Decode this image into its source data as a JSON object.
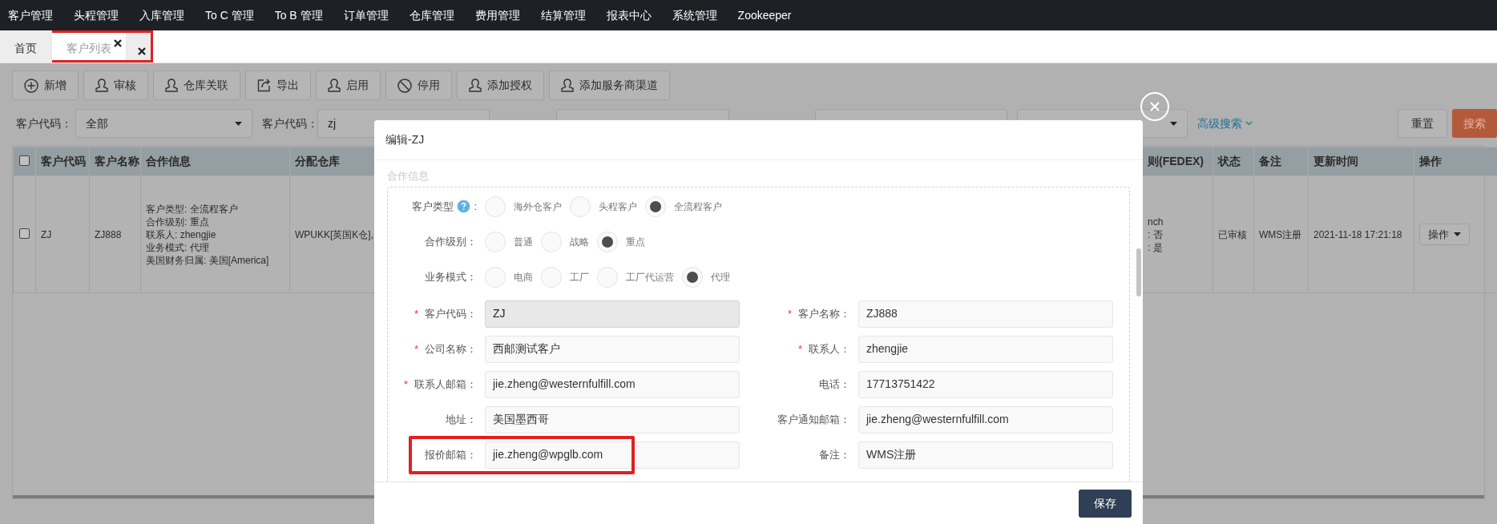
{
  "nav": [
    "客户管理",
    "头程管理",
    "入库管理",
    "To C 管理",
    "To B 管理",
    "订单管理",
    "仓库管理",
    "费用管理",
    "结算管理",
    "报表中心",
    "系统管理",
    "Zookeeper"
  ],
  "tabs": [
    {
      "label": "首页",
      "selected": false,
      "closable": false,
      "highlighted": false
    },
    {
      "label": "客户列表",
      "selected": true,
      "closable": true,
      "highlighted": true
    },
    {
      "selected": false,
      "closable": true,
      "highlighted": true
    }
  ],
  "toolbar": [
    {
      "kind": "plus",
      "label": "新增"
    },
    {
      "kind": "user",
      "label": "审核"
    },
    {
      "kind": "user",
      "label": "仓库关联"
    },
    {
      "kind": "export",
      "label": "导出"
    },
    {
      "kind": "user",
      "label": "启用"
    },
    {
      "kind": "ban",
      "label": "停用"
    },
    {
      "kind": "user",
      "label": "添加授权"
    },
    {
      "kind": "user",
      "label": "添加服务商渠道"
    }
  ],
  "filters": [
    {
      "kind": "select",
      "label": "客户代码：",
      "value": "全部"
    },
    {
      "kind": "text",
      "label": "客户代码：",
      "value": "zj"
    },
    {
      "kind": "text"
    },
    {
      "kind": "text"
    },
    {
      "kind": "select"
    }
  ],
  "advanced_search": "高级搜索",
  "reset_button": "重置",
  "search_button": "搜索",
  "table": {
    "header_checked": false,
    "columns": [
      "客户代码",
      "客户名称",
      "合作信息",
      "分配仓库",
      "则(FEDEX)",
      "状态",
      "备注",
      "更新时间",
      "操作"
    ],
    "rows": [
      {
        "checked": false,
        "cells": [
          "ZJ",
          "ZJ888",
          [
            "客户类型: 全流程客户",
            "合作级别: 重点",
            "联系人: zhengjie",
            "业务模式: 代理",
            "美国财务归属: 美国[America]"
          ],
          "WPUKK[英国K仓],",
          [
            "nch",
            ": 否",
            ": 是"
          ],
          "已审核",
          "WMS注册",
          "2021-11-18 17:21:18",
          {
            "kind": "dropdown",
            "label": "操作"
          }
        ]
      }
    ]
  },
  "modal": {
    "title": "编辑-ZJ",
    "section": "合作信息",
    "radio_groups": [
      {
        "label": "客户类型",
        "help": true,
        "suffix": ":",
        "options": [
          {
            "label": "海外仓客户",
            "selected": false
          },
          {
            "label": "头程客户",
            "selected": false
          },
          {
            "label": "全流程客户",
            "selected": true
          }
        ]
      },
      {
        "label": "合作级别：",
        "help": false,
        "options": [
          {
            "label": "普通",
            "selected": false
          },
          {
            "label": "战略",
            "selected": false
          },
          {
            "label": "重点",
            "selected": true
          }
        ]
      },
      {
        "label": "业务模式：",
        "help": false,
        "options": [
          {
            "label": "电商",
            "selected": false
          },
          {
            "label": "工厂",
            "selected": false
          },
          {
            "label": "工厂代运营",
            "selected": false
          },
          {
            "label": "代理",
            "selected": true
          }
        ]
      }
    ],
    "fields": [
      {
        "required_mark": "*",
        "label": "客户代码：",
        "value": "ZJ",
        "disabled": true,
        "highlighted": false
      },
      {
        "required_mark": "*",
        "label": "客户名称：",
        "value": "ZJ888",
        "disabled": false,
        "highlighted": false
      },
      {
        "required_mark": "*",
        "label": "公司名称：",
        "value": "西邮测试客户",
        "disabled": false,
        "highlighted": false
      },
      {
        "required_mark": "*",
        "label": "联系人：",
        "value": "zhengjie",
        "disabled": false,
        "highlighted": false
      },
      {
        "required_mark": "*",
        "label": "联系人邮箱：",
        "value": "jie.zheng@westernfulfill.com",
        "disabled": false,
        "highlighted": false
      },
      {
        "label": "电话：",
        "value": "17713751422",
        "disabled": false,
        "highlighted": false
      },
      {
        "label": "地址：",
        "value": "美国墨西哥",
        "disabled": false,
        "highlighted": false
      },
      {
        "label": "客户通知邮箱：",
        "value": "jie.zheng@westernfulfill.com",
        "disabled": false,
        "highlighted": false
      },
      {
        "label": "报价邮箱：",
        "value": "jie.zheng@wpglb.com",
        "disabled": false,
        "highlighted": true
      },
      {
        "label": "备注：",
        "value": "WMS注册",
        "disabled": false,
        "highlighted": false
      }
    ],
    "save_button": "保存"
  }
}
